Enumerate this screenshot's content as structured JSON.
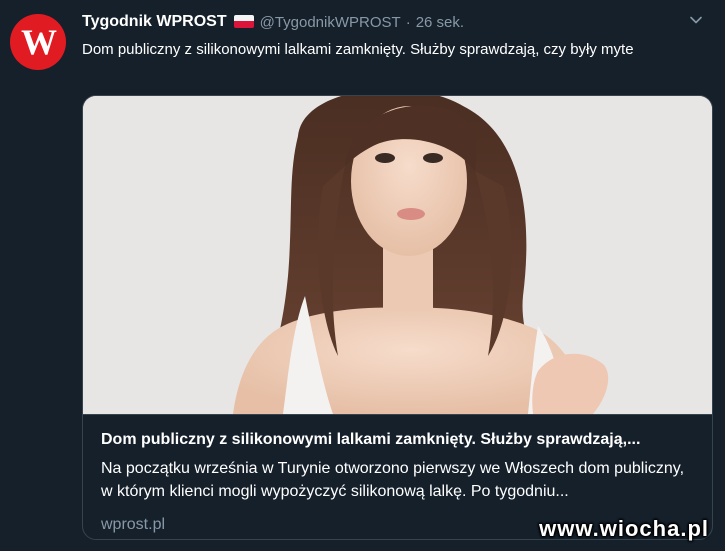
{
  "account": {
    "avatar_letter": "W",
    "avatar_color": "#e11b22",
    "name": "Tygodnik WPROST",
    "flag_icon": "poland-flag-icon",
    "handle": "@TygodnikWPROST",
    "separator": "·",
    "time": "26 sek."
  },
  "tweet": {
    "text": "Dom publiczny z silikonowymi lalkami zamknięty. Służby sprawdzają, czy były myte"
  },
  "card": {
    "title": "Dom publiczny z silikonowymi lalkami zamknięty. Służby sprawdzają,...",
    "description": "Na początku września w Turynie otworzono pierwszy we Włoszech dom publiczny, w którym klienci mogli wypożyczyć silikonową lalkę. Po tygodniu...",
    "domain": "wprost.pl"
  },
  "watermark": "www.wiocha.pl",
  "colors": {
    "background": "#15202b",
    "border": "#38444d",
    "secondary_text": "#8899a6"
  }
}
